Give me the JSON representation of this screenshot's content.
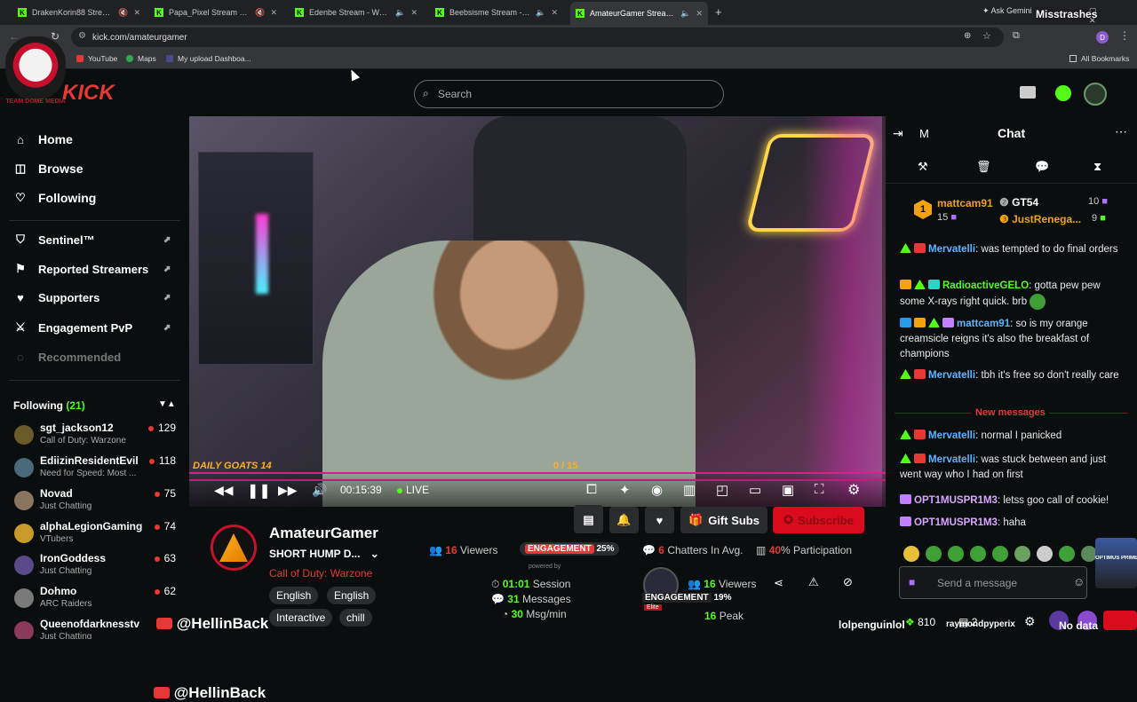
{
  "browser": {
    "tabs": [
      {
        "title": "DrakenKorin88 Stream - W"
      },
      {
        "title": "Papa_Pixel Stream - Watch"
      },
      {
        "title": "Edenbe Stream - Watch Liv"
      },
      {
        "title": "Beebsisme Stream - Watch"
      },
      {
        "title": "AmateurGamer Stream - W"
      }
    ],
    "ask_gemini": "Ask Gemini",
    "url": "kick.com/amateurgamer",
    "profile_initial": "D",
    "bookmarks": [
      "YouTube",
      "Maps",
      "My upload Dashboa..."
    ],
    "all_bookmarks": "All Bookmarks"
  },
  "overlay": {
    "top_right_name": "Misstrashes",
    "logo_text": "TEAM DOME MEDIA",
    "kick_logo": "KICK",
    "bottom_handle": "@HellinBack",
    "bottom_right_user": "lolpenguinlol",
    "bottom_right_user2": "raymondpyperix",
    "no_data": "No data",
    "optimus_tag": "OPTIMUS PRIME"
  },
  "search": {
    "placeholder": "Search"
  },
  "sidebar": {
    "nav": [
      {
        "label": "Home",
        "icon": "home-icon"
      },
      {
        "label": "Browse",
        "icon": "browse-icon"
      },
      {
        "label": "Following",
        "icon": "heart-icon"
      }
    ],
    "tools": [
      {
        "label": "Sentinel™",
        "icon": "shield-icon"
      },
      {
        "label": "Reported Streamers",
        "icon": "flag-icon"
      },
      {
        "label": "Supporters",
        "icon": "heart-icon"
      },
      {
        "label": "Engagement PvP",
        "icon": "swords-icon"
      },
      {
        "label": "Recommended",
        "icon": "eye-off-icon"
      }
    ],
    "following_title": "Following",
    "following_count": "(21)",
    "following": [
      {
        "name": "sgt_jackson12",
        "category": "Call of Duty: Warzone",
        "viewers": "129",
        "color": "#6b5a2a"
      },
      {
        "name": "EdiizinResidentEvil",
        "category": "Need for Speed: Most ...",
        "viewers": "118",
        "color": "#4a6a7a"
      },
      {
        "name": "Novad",
        "category": "Just Chatting",
        "viewers": "75",
        "color": "#8a7560"
      },
      {
        "name": "alphaLegionGaming",
        "category": "VTubers",
        "viewers": "74",
        "color": "#c89a2a"
      },
      {
        "name": "IronGoddess",
        "category": "Just Chatting",
        "viewers": "63",
        "color": "#5a4a8a"
      },
      {
        "name": "Dohmo",
        "category": "ARC Raiders",
        "viewers": "62",
        "color": "#7a7a7a"
      },
      {
        "name": "Queenofdarknesstv",
        "category": "Just Chatting",
        "viewers": "",
        "color": "#8a3a5a"
      }
    ]
  },
  "video": {
    "overlay_left": "DAILY GOATS",
    "overlay_left_num": "14",
    "overlay_right": "0 / 15",
    "time": "00:15:39",
    "live": "LIVE"
  },
  "channel": {
    "name": "AmateurGamer",
    "title": "SHORT HUMP D...",
    "category": "Call of Duty: Warzone",
    "tags": [
      "English",
      "English",
      "Interactive",
      "chill"
    ],
    "gift_subs": "Gift Subs",
    "subscribe": "Subscribe",
    "viewers_num": "16",
    "viewers_label": "Viewers",
    "engagement_label": "ENGAGEMENT",
    "engagement_pct": "25%",
    "chatters_num": "6",
    "chatters_label": "Chatters In Avg.",
    "participation_num": "40",
    "participation_label": "% Participation",
    "powered_by": "powered by",
    "session_time": "01:01",
    "session_label": "Session",
    "messages_num": "31",
    "messages_label": "Messages",
    "msg_rate_num": "30",
    "msg_rate_label": "Msg/min",
    "viewers2_num": "16",
    "viewers2_label": "Viewers",
    "engagement2_label": "ENGAGEMENT",
    "engagement2_pct": "19%",
    "peak_num": "16",
    "peak_label": "Peak",
    "elite_label": "Elite",
    "chat_points": "810",
    "chat_count": "2"
  },
  "chat": {
    "title": "Chat",
    "mode": "M",
    "leaderboard": [
      {
        "rank": "1",
        "name": "mattcam91",
        "count": "15",
        "side_name": "GT54",
        "side_count": "10"
      },
      {
        "rank": "2",
        "name": "",
        "count": "",
        "side_name": "JustRenega...",
        "side_count": "9"
      }
    ],
    "messages": [
      {
        "user": "Mervatelli",
        "color": "#5ab4ff",
        "text": "was tempted to do final orders"
      },
      {
        "user": "RadioactiveGELO",
        "color": "#53fc18",
        "text": "gotta pew pew some X-rays right quick. brb"
      },
      {
        "user": "mattcam91",
        "color": "#5ab4ff",
        "text": "so is my orange creamsicle reigns it's also the breakfast of champions"
      },
      {
        "user": "Mervatelli",
        "color": "#5ab4ff",
        "text": "tbh it's free so don't really care"
      }
    ],
    "new_messages": "New messages",
    "messages2": [
      {
        "user": "Mervatelli",
        "color": "#5ab4ff",
        "text": "normal I panicked"
      },
      {
        "user": "Mervatelli",
        "color": "#5ab4ff",
        "text": "was stuck between and just went way who I had on first"
      },
      {
        "user": "OPT1MUSPR1M3",
        "color": "#d6a5ff",
        "text": "letss goo call of cookie!"
      },
      {
        "user": "OPT1MUSPR1M3",
        "color": "#d6a5ff",
        "text": "haha"
      }
    ],
    "send_placeholder": "Send a message"
  },
  "colors": {
    "accent": "#53fc18",
    "red": "#e53935",
    "subscribe": "#d90b1c"
  }
}
